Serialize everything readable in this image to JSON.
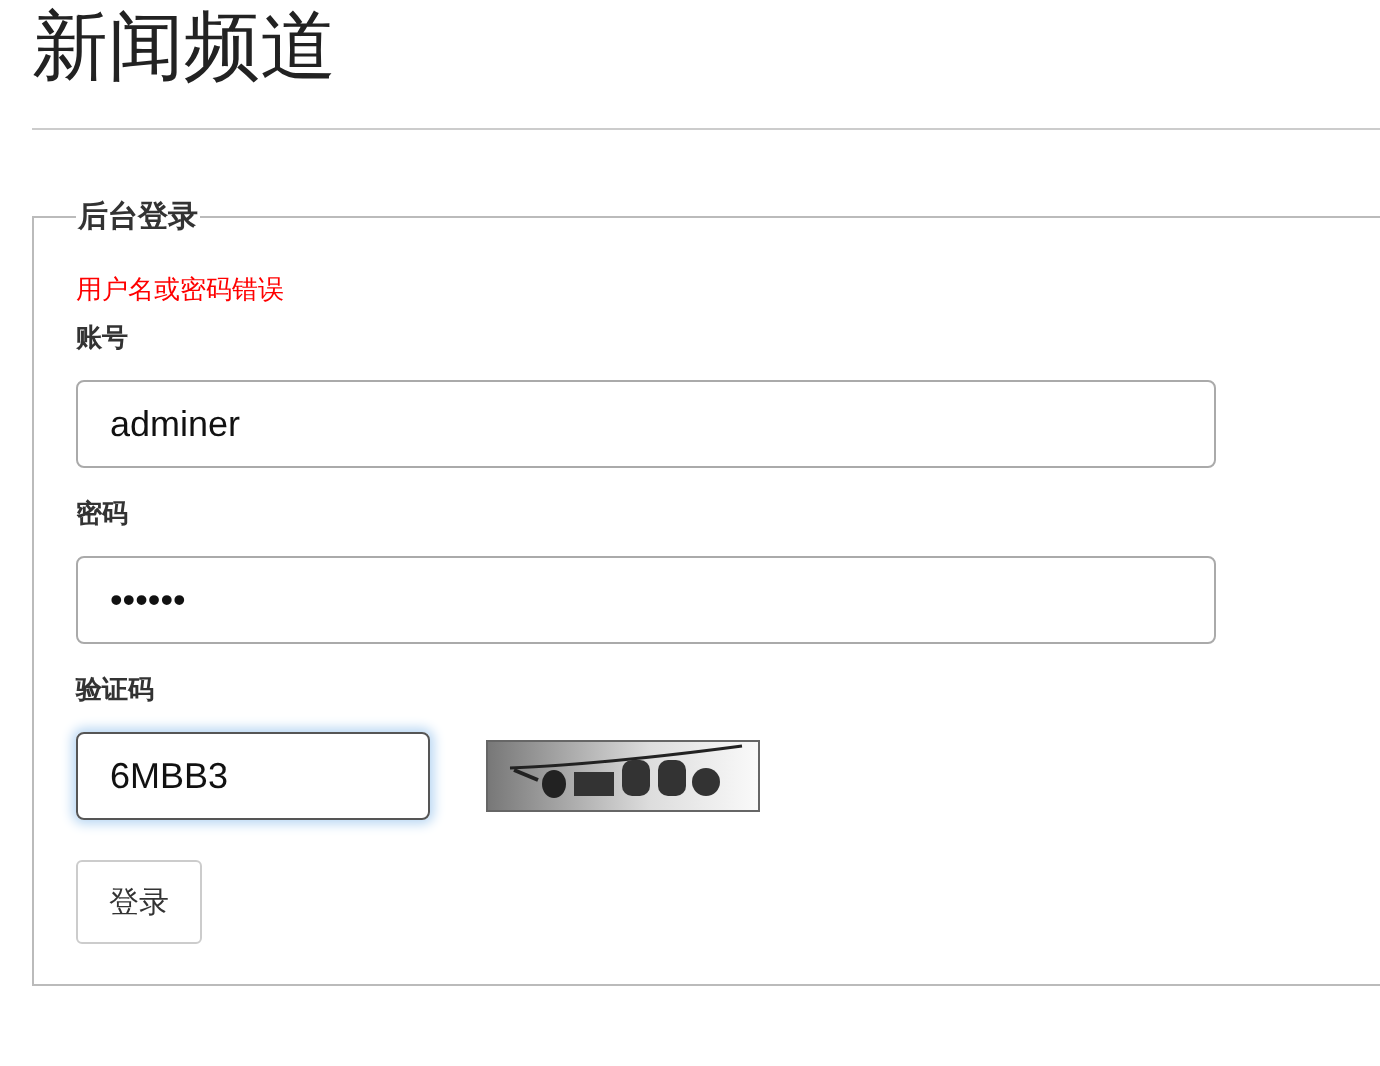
{
  "page_title": "新闻频道",
  "login": {
    "legend": "后台登录",
    "error": "用户名或密码错误",
    "fields": [
      {
        "kind": "text",
        "label": "账号",
        "value": "adminer",
        "focused": false
      },
      {
        "kind": "password",
        "label": "密码",
        "value": "••••••",
        "focused": false
      },
      {
        "kind": "captcha",
        "label": "验证码",
        "value": "6MBB3",
        "focused": true
      }
    ],
    "submit": "登录"
  }
}
